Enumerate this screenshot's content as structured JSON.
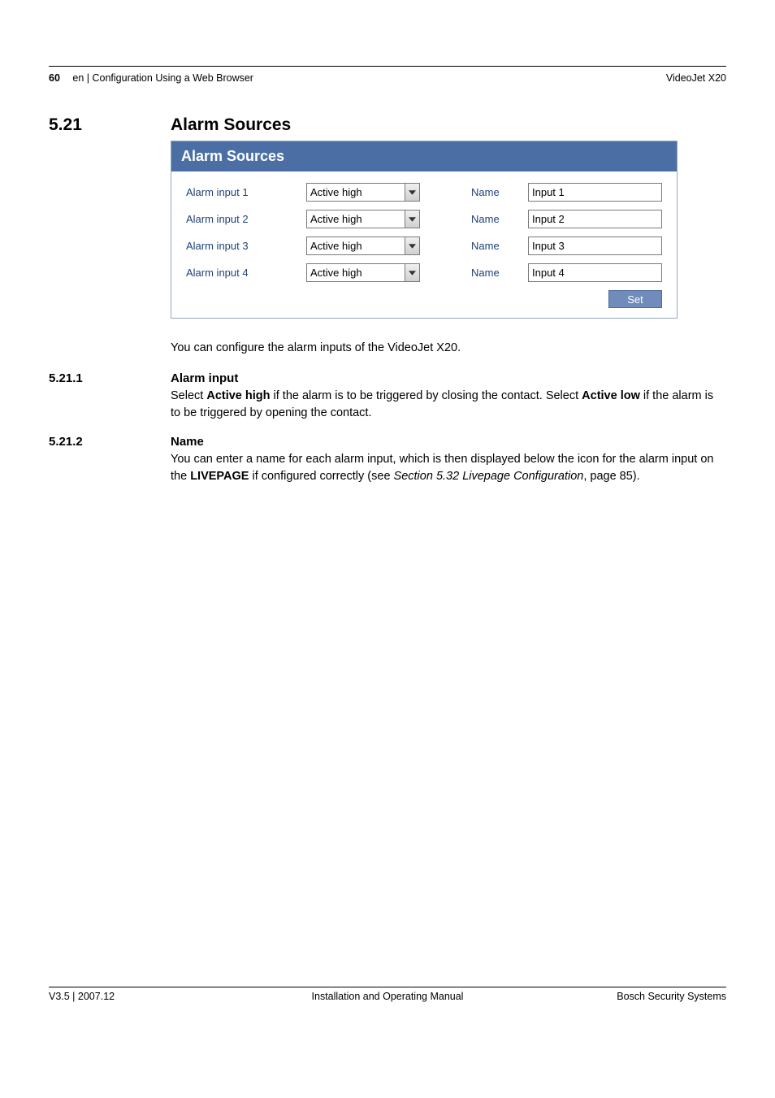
{
  "header": {
    "page_number": "60",
    "breadcrumb": "en | Configuration Using a Web Browser",
    "product": "VideoJet X20"
  },
  "section": {
    "number": "5.21",
    "title": "Alarm Sources"
  },
  "panel": {
    "title": "Alarm Sources",
    "name_column_label": "Name",
    "rows": [
      {
        "label": "Alarm input 1",
        "dropdown": "Active high",
        "name_value": "Input 1"
      },
      {
        "label": "Alarm input 2",
        "dropdown": "Active high",
        "name_value": "Input 2"
      },
      {
        "label": "Alarm input 3",
        "dropdown": "Active high",
        "name_value": "Input 3"
      },
      {
        "label": "Alarm input 4",
        "dropdown": "Active high",
        "name_value": "Input 4"
      }
    ],
    "set_button": "Set"
  },
  "text": {
    "intro": "You can configure the alarm inputs of the VideoJet X20.",
    "sub1_num": "5.21.1",
    "sub1_title": "Alarm input",
    "sub1_a": "Select ",
    "sub1_b": "Active high",
    "sub1_c": " if the alarm is to be triggered by closing the contact. Select ",
    "sub1_d": "Active low",
    "sub1_e": " if the alarm is to be triggered by opening the contact.",
    "sub2_num": "5.21.2",
    "sub2_title": "Name",
    "sub2_a": "You can enter a name for each alarm input, which is then displayed below the icon for the alarm input on the ",
    "sub2_b": "LIVEPAGE",
    "sub2_c": " if configured correctly (see ",
    "sub2_d": "Section 5.32 Livepage Configuration",
    "sub2_e": ", page 85)."
  },
  "footer": {
    "left": "V3.5 | 2007.12",
    "center": "Installation and Operating Manual",
    "right": "Bosch Security Systems"
  }
}
